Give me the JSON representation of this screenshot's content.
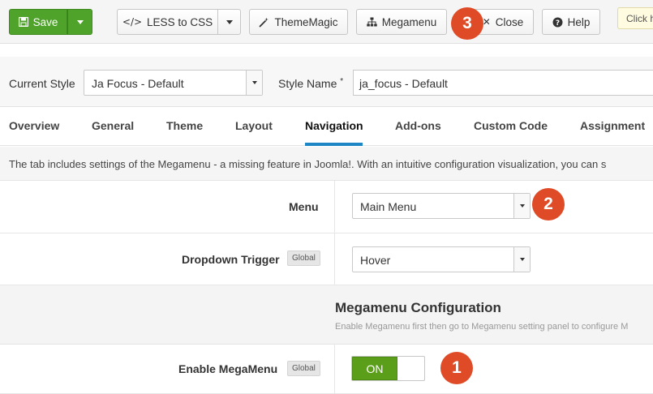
{
  "toolbar": {
    "save_label": "Save",
    "less_to_css_label": "LESS to CSS",
    "thememagic_label": "ThemeMagic",
    "megamenu_label": "Megamenu",
    "close_label": "Close",
    "help_label": "Help",
    "tooltip_text": "Click h"
  },
  "style": {
    "current_style_label": "Current Style",
    "current_style_value": "Ja Focus - Default",
    "style_name_label": "Style Name",
    "style_name_required": "*",
    "style_name_value": "ja_focus - Default"
  },
  "tabs": [
    {
      "label": "Overview"
    },
    {
      "label": "General"
    },
    {
      "label": "Theme"
    },
    {
      "label": "Layout"
    },
    {
      "label": "Navigation",
      "active": true
    },
    {
      "label": "Add-ons"
    },
    {
      "label": "Custom Code"
    },
    {
      "label": "Assignment"
    }
  ],
  "description": "The tab includes settings of the Megamenu - a missing feature in Joomla!. With an intuitive configuration visualization, you can s",
  "fields": {
    "menu_label": "Menu",
    "menu_value": "Main Menu",
    "dropdown_trigger_label": "Dropdown Trigger",
    "dropdown_trigger_value": "Hover",
    "global_badge": "Global",
    "enable_megamenu_label": "Enable MegaMenu",
    "enable_megamenu_value": "ON"
  },
  "section": {
    "title": "Megamenu Configuration",
    "subtitle": "Enable Megamenu first then go to Megamenu setting panel to configure M"
  },
  "callouts": {
    "one": "1",
    "two": "2",
    "three": "3"
  },
  "colors": {
    "save_green": "#4fa32a",
    "callout_red": "#e04b27",
    "active_tab_blue": "#1f86c6",
    "toggle_on_green": "#5a9e1a"
  }
}
